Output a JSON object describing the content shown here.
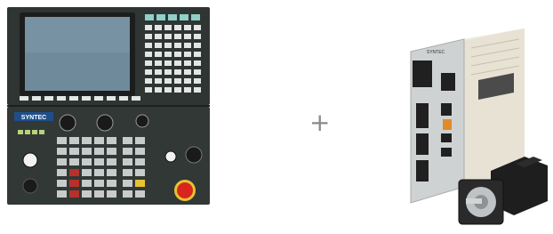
{
  "controller": {
    "brand": "SYNTEC"
  },
  "drive": {
    "brand": "SYNTEC"
  },
  "separator": {
    "symbol": "+"
  },
  "colors": {
    "panel": "#2f3533",
    "screen": "#6f8a9a",
    "key_light": "#e4e6e6",
    "key_teal": "#8fd0c7",
    "drive_body": "#e7e2d4",
    "drive_face": "#cfd2d3",
    "estop": "#d8261e",
    "motor": "#1e1e1e"
  }
}
